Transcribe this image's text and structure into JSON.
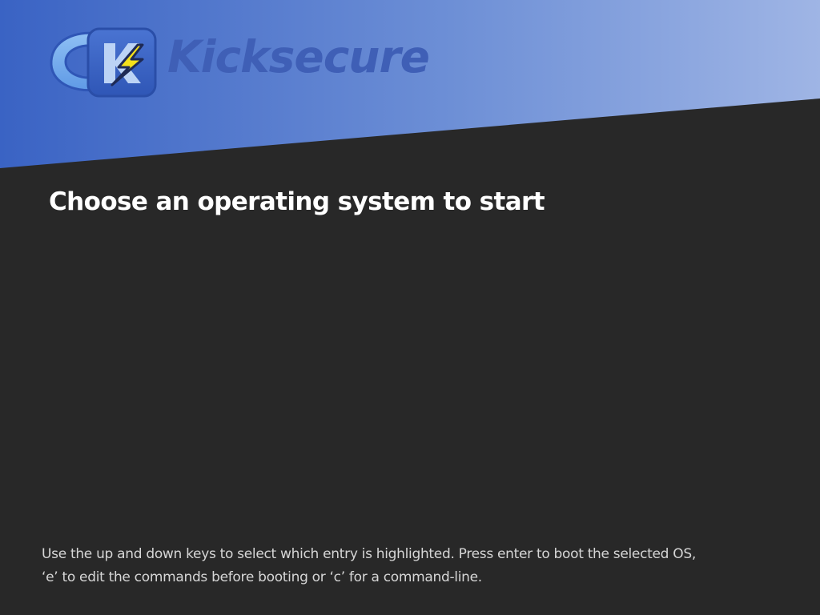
{
  "brand": {
    "name": "Kicksecure",
    "logo_icon": "kicksecure-logo-icon",
    "text_color": "#3f5fb6"
  },
  "banner": {
    "gradient_start": "#3a63c4",
    "gradient_end": "#9eb4e4"
  },
  "menu": {
    "title": "Choose an operating system to start",
    "entries": []
  },
  "help": {
    "line1": "Use the up and down keys to select which entry is highlighted. Press enter to boot the selected OS,",
    "line2": "‘e’ to edit the commands before booting or ‘c’ for a command-line."
  },
  "colors": {
    "background": "#282828",
    "title": "#ffffff",
    "help_text": "#d6d6d6"
  }
}
